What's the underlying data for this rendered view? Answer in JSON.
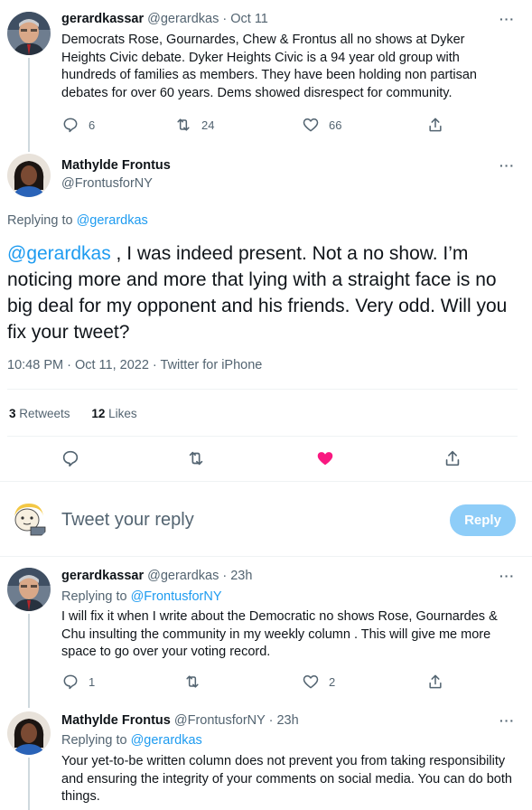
{
  "tweet1": {
    "name": "gerardkassar",
    "handle": "@gerardkas",
    "dot": "·",
    "date": "Oct 11",
    "text": "Democrats Rose, Gournardes, Chew & Frontus all no shows at Dyker Heights Civic debate. Dyker Heights Civic is a 94 year old group with hundreds of families as members. They have been holding non partisan debates for over 60 years. Dems showed disrespect for community.",
    "replies": "6",
    "retweets": "24",
    "likes": "66"
  },
  "main": {
    "name": "Mathylde Frontus",
    "handle": "@FrontusforNY",
    "replying_label": "Replying to",
    "replying_handle": "@gerardkas",
    "mention": "@gerardkas",
    "text": " , I was indeed present. Not a no show. I’m noticing more and more that lying with a straight face is no big deal for my opponent and his friends. Very odd. Will you fix your tweet?",
    "timestamp": "10:48 PM · Oct 11, 2022 · Twitter for iPhone",
    "retweet_count": "3",
    "retweet_label": "Retweets",
    "like_count": "12",
    "like_label": "Likes"
  },
  "compose": {
    "placeholder": "Tweet your reply",
    "button": "Reply"
  },
  "reply1": {
    "name": "gerardkassar",
    "handle": "@gerardkas",
    "dot": "·",
    "time": "23h",
    "replying_label": "Replying to",
    "replying_handle": "@FrontusforNY",
    "text": "I will fix it when I write about the Democratic no shows Rose, Gournardes & Chu insulting the community in my weekly column . This will give me more space to go over your voting record.",
    "replies": "1",
    "likes": "2"
  },
  "reply2": {
    "name": "Mathylde Frontus",
    "handle": "@FrontusforNY",
    "dot": "·",
    "time": "23h",
    "replying_label": "Replying to",
    "replying_handle": "@gerardkas",
    "text": "Your yet-to-be written column does not prevent you from taking responsibility and ensuring the integrity of your comments on social media. You can do both things."
  },
  "more_icon": "···",
  "colors": {
    "accent": "#1d9bf0",
    "like": "#f91880",
    "reply_button": "#8ecdf8"
  }
}
